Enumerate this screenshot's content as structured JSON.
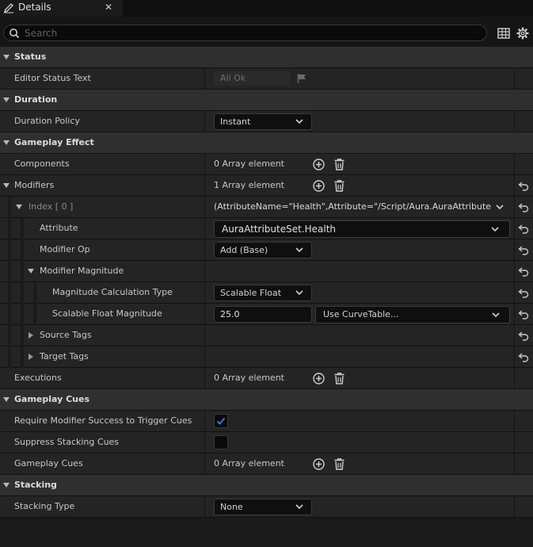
{
  "tab": {
    "title": "Details",
    "close_glyph": "✕",
    "icon": "pencil-icon"
  },
  "search": {
    "placeholder": "Search",
    "value": ""
  },
  "toolbar": {
    "table_icon": "table-icon",
    "settings_icon": "gear-icon"
  },
  "status": {
    "category": "Status",
    "editor_status_text": {
      "label": "Editor Status Text",
      "value": "All Ok"
    }
  },
  "duration": {
    "category": "Duration",
    "duration_policy": {
      "label": "Duration Policy",
      "value": "Instant"
    }
  },
  "gameplay_effect": {
    "category": "Gameplay Effect",
    "components": {
      "label": "Components",
      "value": "0 Array element"
    },
    "modifiers": {
      "label": "Modifiers",
      "value": "1 Array element",
      "index0": {
        "label": "Index [ 0 ]",
        "value": "(AttributeName=\"Health\",Attribute=\"/Script/Aura.AuraAttributeSet:H",
        "attribute": {
          "label": "Attribute",
          "value": "AuraAttributeSet.Health"
        },
        "modifier_op": {
          "label": "Modifier Op",
          "value": "Add (Base)"
        },
        "modifier_magnitude": {
          "label": "Modifier Magnitude",
          "calc_type": {
            "label": "Magnitude Calculation Type",
            "value": "Scalable Float"
          },
          "scalable_float": {
            "label": "Scalable Float Magnitude",
            "value": "25.0",
            "curve": "Use CurveTable..."
          }
        },
        "source_tags": {
          "label": "Source Tags"
        },
        "target_tags": {
          "label": "Target Tags"
        }
      }
    },
    "executions": {
      "label": "Executions",
      "value": "0 Array element"
    }
  },
  "gameplay_cues": {
    "category": "Gameplay Cues",
    "require_success": {
      "label": "Require Modifier Success to Trigger Cues",
      "checked": true
    },
    "suppress_stacking": {
      "label": "Suppress Stacking Cues",
      "checked": false
    },
    "cues": {
      "label": "Gameplay Cues",
      "value": "0 Array element"
    }
  },
  "stacking": {
    "category": "Stacking",
    "stacking_type": {
      "label": "Stacking Type",
      "value": "None"
    }
  },
  "colors": {
    "accent": "#2a7de1",
    "background": "#1a1a1a",
    "row": "#242424",
    "category": "#2f2f2f"
  }
}
